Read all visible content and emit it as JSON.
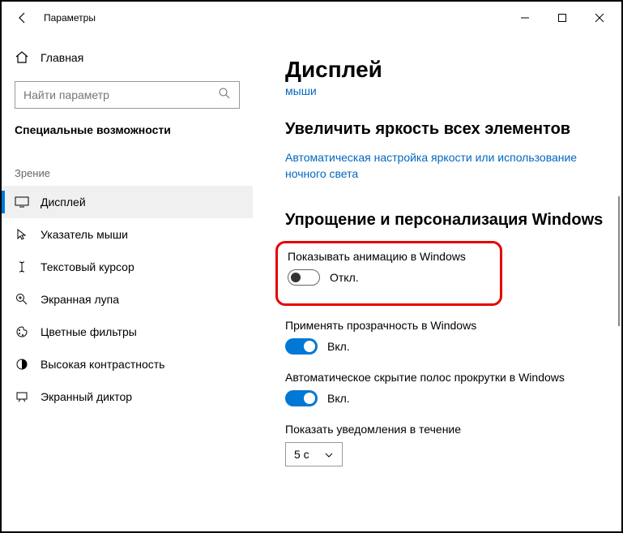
{
  "titlebar": {
    "title": "Параметры"
  },
  "sidebar": {
    "home": "Главная",
    "search_placeholder": "Найти параметр",
    "category": "Специальные возможности",
    "group": "Зрение",
    "items": [
      {
        "label": "Дисплей"
      },
      {
        "label": "Указатель мыши"
      },
      {
        "label": "Текстовый курсор"
      },
      {
        "label": "Экранная лупа"
      },
      {
        "label": "Цветные фильтры"
      },
      {
        "label": "Высокая контрастность"
      },
      {
        "label": "Экранный диктор"
      }
    ]
  },
  "main": {
    "heading": "Дисплей",
    "truncated_link": "мыши",
    "section1_title": "Увеличить яркость всех элементов",
    "section1_link": "Автоматическая настройка яркости или использование ночного света",
    "section2_title": "Упрощение и персонализация Windows",
    "toggles": [
      {
        "label": "Показывать анимацию в Windows",
        "state": "Откл."
      },
      {
        "label": "Применять прозрачность в Windows",
        "state": "Вкл."
      },
      {
        "label": "Автоматическое скрытие полос прокрутки в Windows",
        "state": "Вкл."
      }
    ],
    "notif_label": "Показать уведомления в течение",
    "notif_value": "5 с"
  }
}
